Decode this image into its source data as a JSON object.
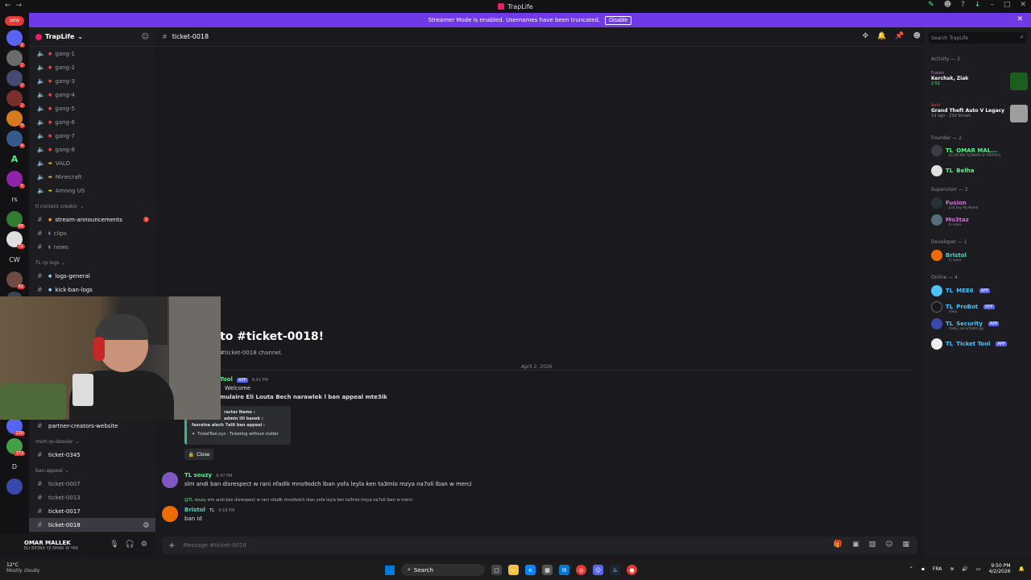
{
  "window": {
    "title": "TrapLife"
  },
  "banner": {
    "text": "Streamer Mode is enabled. Usernames have been truncated.",
    "button": "Disable"
  },
  "servers": {
    "new_badge": "NEW",
    "labels": [
      "A",
      "rs",
      "CW",
      "D"
    ],
    "badges": [
      "2",
      "2",
      "2",
      "2",
      "9",
      "4",
      "5",
      "68",
      "72",
      "42",
      "401",
      "220",
      "373"
    ]
  },
  "guild": {
    "name": "TrapLife"
  },
  "channels": {
    "voice": [
      "gang-1",
      "gang-2",
      "gang-3",
      "gang-4",
      "gang-5",
      "gang-6",
      "gang-7",
      "gang-8",
      "VALO",
      "Minecraft",
      "Among US"
    ],
    "cat_content": "tl content creator",
    "content": [
      "stream-announcements",
      "clips",
      "news"
    ],
    "cat_logs": "TL rp logs",
    "logs": [
      "logs-general",
      "kick-ban-logs"
    ],
    "partner": "partner-creators-website",
    "cat_dossier": "mort-rp-dossier",
    "dossier": [
      "ticket-0345"
    ],
    "cat_appeal": "ban-appeal",
    "appeal": [
      "ticket-0007",
      "ticket-0013",
      "ticket-0017",
      "ticket-0018"
    ],
    "unread": "9"
  },
  "user": {
    "name": "OMAR MALLEK",
    "status": "ELI BE3NA YJI NHAR W YAR"
  },
  "topbar": {
    "channel": "ticket-0018"
  },
  "welcome": {
    "title": "to #ticket-0018!",
    "subtitle": "#ticket-0018 channel."
  },
  "date_divider": "April 2, 2026",
  "messages": {
    "ticket": {
      "name": "Tool",
      "tag": "APP",
      "time": "6:41 PM",
      "line1": "Welcome",
      "line2": "mulaire Eli Louta Bech narawlek l ban appeal mte3ik",
      "embed1": "racter Name :",
      "embed2": "admin illi banek :",
      "embed3": "fasrelna alech 7alit ban appeal :",
      "embed_footer": "TicketTool.xyz - Ticketing without clutter",
      "close": "Close"
    },
    "souzy": {
      "prefix": "TL",
      "name": "souzy",
      "time": "8:47 PM",
      "text": "slm andi ban disrespect w rani nfadlk mno9sdch lban yofa leyla ken ta3mlo mzya na7oli lban w merci"
    },
    "bristol": {
      "reply_author": "@TL",
      "reply_name": "souzy",
      "reply_text": "slm andi ban disrespect w rani nfadlk mno9sdch lban yofa leyla ken ta3mlo mzya na7oli lban w merci",
      "name": "Bristol",
      "tag": "TL",
      "time": "9:18 PM",
      "text": "ban id"
    }
  },
  "composer": {
    "placeholder": "Message #ticket-0018"
  },
  "members": {
    "search": "Search TrapLife",
    "activity_title": "Activity — 2",
    "activity": [
      {
        "user": "Fusion",
        "title": "Kerchak, Ziak",
        "sub": "2:51"
      },
      {
        "user": "Aadi",
        "title": "Grand Theft Auto V Legacy",
        "sub": "1d ago · 23d Streak"
      }
    ],
    "founder_title": "Founder — 2",
    "founders": [
      {
        "prefix": "TL",
        "name": "OMAR MAL...",
        "sub": "ELI BE3NA YJI NHAR W YARTHA3"
      },
      {
        "prefix": "TL",
        "name": "Belha",
        "sub": ""
      }
    ],
    "supervisor_title": "Supervisor — 2",
    "supervisors": [
      {
        "name": "Fusion",
        "sub": "Just Say My Name"
      },
      {
        "name": "Mo3taz",
        "sub": "In voice"
      }
    ],
    "developer_title": "Developer — 1",
    "developers": [
      {
        "name": "Bristol",
        "sub": "In voice"
      }
    ],
    "online_title": "Online — 4",
    "online": [
      {
        "prefix": "TL",
        "name": "MEE6",
        "tag": "APP",
        "sub": ""
      },
      {
        "prefix": "TL",
        "name": "ProBot",
        "tag": "APP",
        "sub": "/help"
      },
      {
        "prefix": "TL",
        "name": "Security",
        "tag": "APP",
        "sub": "/help | securitybot.gg"
      },
      {
        "prefix": "TL",
        "name": "Ticket Tool",
        "tag": "APP",
        "sub": ""
      }
    ]
  },
  "taskbar": {
    "temp": "12°C",
    "weather": "Mostly cloudy",
    "search": "Search",
    "lang": "FRA",
    "time": "9:50 PM",
    "date": "4/2/2026"
  },
  "colors": {
    "accent": "#6f39e8",
    "founder": "#57f287",
    "supervisor": "#d96bd6",
    "developer": "#5ad0c4",
    "bot": "#4fc3f7"
  }
}
